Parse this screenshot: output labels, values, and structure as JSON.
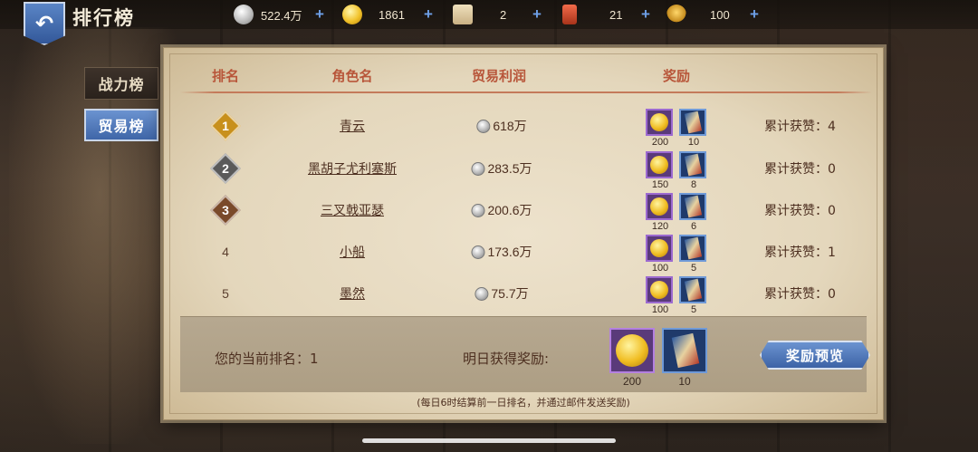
{
  "header": {
    "back_icon": "back-arrow-icon",
    "title": "排行榜"
  },
  "resources": [
    {
      "name": "silver",
      "icon": "silver-coin-icon",
      "value": "522.4万"
    },
    {
      "name": "gold",
      "icon": "gold-coin-icon",
      "value": "1861"
    },
    {
      "name": "scroll",
      "icon": "scroll-icon",
      "value": "2"
    },
    {
      "name": "card",
      "icon": "card-icon",
      "value": "21"
    },
    {
      "name": "honor",
      "icon": "laurel-icon",
      "value": "100"
    }
  ],
  "tabs": [
    {
      "label": "战力榜",
      "active": false
    },
    {
      "label": "贸易榜",
      "active": true
    }
  ],
  "table": {
    "headers": [
      "排名",
      "角色名",
      "贸易利润",
      "奖励"
    ],
    "rows": [
      {
        "rank": "1",
        "name": "青云",
        "profit": "618万",
        "gold": "200",
        "cards": "10",
        "likes": "累计获赞：4"
      },
      {
        "rank": "2",
        "name": "黑胡子尤利塞斯",
        "profit": "283.5万",
        "gold": "150",
        "cards": "8",
        "likes": "累计获赞：0"
      },
      {
        "rank": "3",
        "name": "三叉戟亚瑟",
        "profit": "200.6万",
        "gold": "120",
        "cards": "6",
        "likes": "累计获赞：0"
      },
      {
        "rank": "4",
        "name": "小船",
        "profit": "173.6万",
        "gold": "100",
        "cards": "5",
        "likes": "累计获赞：1"
      },
      {
        "rank": "5",
        "name": "墨然",
        "profit": "75.7万",
        "gold": "100",
        "cards": "5",
        "likes": "累计获赞：0"
      }
    ]
  },
  "footer": {
    "current_rank": "您的当前排名：1",
    "tomorrow_label": "明日获得奖励:",
    "tomorrow_gold": "200",
    "tomorrow_cards": "10",
    "preview_button": "奖励预览",
    "note": "(每日6时结算前一日排名，并通过邮件发送奖励)"
  },
  "colors": {
    "rank1": "#c8901c",
    "rank2": "#5a5a5a",
    "rank3": "#7a4a2a",
    "header_text": "#b8563a",
    "accent_blue": "#4f76b8"
  }
}
